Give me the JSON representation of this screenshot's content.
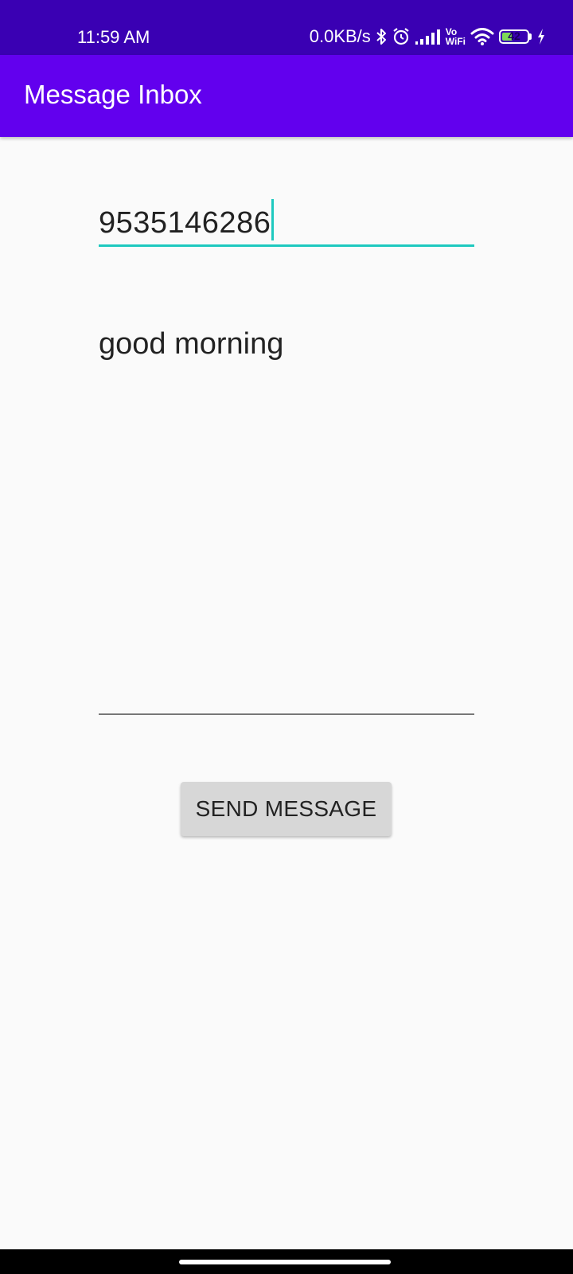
{
  "status_bar": {
    "time": "11:59 AM",
    "net_speed": "0.0KB/s",
    "vowifi_top": "Vo",
    "vowifi_bottom": "WiFi",
    "battery_level": "42",
    "battery_fraction": 0.42,
    "icons": [
      "bluetooth-icon",
      "alarm-icon",
      "signal-icon",
      "wifi-icon",
      "battery-icon",
      "charging-icon"
    ],
    "background_color": "#3a00b3"
  },
  "app_bar": {
    "title": "Message Inbox",
    "background_color": "#6200ee"
  },
  "form": {
    "phone_value": "9535146286",
    "message_value": "good morning",
    "accent_color": "#1ec9bf"
  },
  "actions": {
    "send_label": "SEND MESSAGE"
  }
}
